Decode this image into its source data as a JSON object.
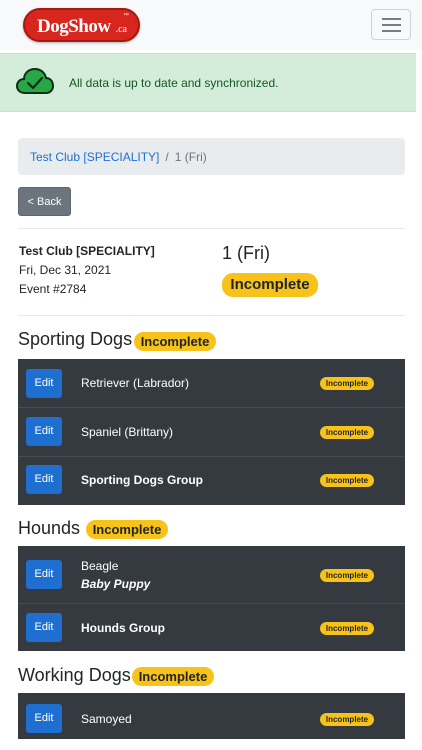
{
  "navbar": {
    "logo": {
      "brand": "DogShow",
      "tld": ".ca",
      "tm": "™"
    },
    "menu_icon": "hamburger-menu-icon"
  },
  "alert": {
    "icon": "cloud-check-icon",
    "message": "All data is up to date and synchronized."
  },
  "breadcrumb": {
    "club_link": "Test Club [SPECIALITY]",
    "separator": "/",
    "current": "1 (Fri)"
  },
  "back_button": "< Back",
  "event": {
    "club_name": "Test Club [SPECIALITY]",
    "date": "Fri, Dec 31, 2021",
    "event_number": "Event #2784",
    "show_day": "1 (Fri)",
    "status": "Incomplete"
  },
  "groups": [
    {
      "title": "Sporting Dogs",
      "status": "Incomplete",
      "rows": [
        {
          "edit": "Edit",
          "label": "Retriever (Labrador)",
          "status": "Incomplete"
        },
        {
          "edit": "Edit",
          "label": "Spaniel (Brittany)",
          "status": "Incomplete"
        },
        {
          "edit": "Edit",
          "label": "Sporting Dogs Group",
          "status": "Incomplete"
        }
      ]
    },
    {
      "title": "Hounds",
      "status": "Incomplete",
      "rows": [
        {
          "edit": "Edit",
          "label": "Beagle",
          "sublabel": "Baby Puppy",
          "status": "Incomplete"
        },
        {
          "edit": "Edit",
          "label": "Hounds Group",
          "status": "Incomplete"
        }
      ]
    },
    {
      "title": "Working Dogs",
      "status": "Incomplete",
      "rows": [
        {
          "edit": "Edit",
          "label": "Samoyed",
          "status": "Incomplete"
        }
      ]
    }
  ],
  "colors": {
    "brand_red": "#d7261e",
    "success_bg": "#d4edda",
    "warning": "#f7c21a",
    "primary": "#1f6fd0",
    "dark_table": "#343a40"
  }
}
